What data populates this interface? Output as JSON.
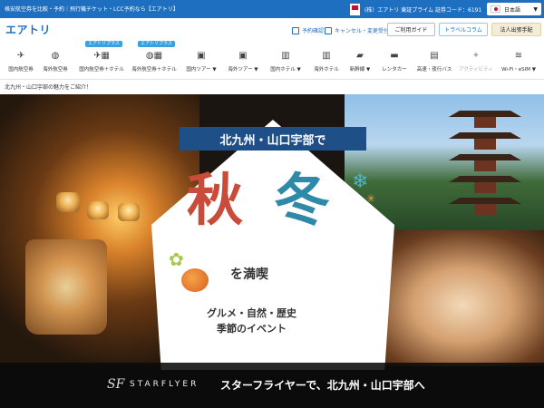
{
  "topbar": {
    "tagline": "格安航空券を比較・予約｜飛行機チケット・LCC予約なら【エアトリ】",
    "company_info": "(株）エアトリ 東証プライム 証券コード：6191",
    "language": "日本語",
    "language_caret": "▼"
  },
  "header": {
    "logo": "エアトリ",
    "links": [
      "予約確認",
      "キャンセル・変更受付"
    ],
    "buttons": [
      "ご利用ガイド",
      "トラベルコラム",
      "法人出張手配"
    ]
  },
  "nav": {
    "badge": "エアトリプラス",
    "items": [
      {
        "label": "国内航空券",
        "icon": "airplane-icon",
        "glyph": "✈"
      },
      {
        "label": "海外航空券",
        "icon": "globe-icon",
        "glyph": "◍"
      },
      {
        "label": "国内航空券＋ホテル",
        "icon": "plane-hotel-icon",
        "glyph": "✈▦"
      },
      {
        "label": "海外航空券＋ホテル",
        "icon": "globe-hotel-icon",
        "glyph": "◍▦"
      },
      {
        "label": "国内ツアー ▼",
        "icon": "suitcase-icon",
        "glyph": "▣"
      },
      {
        "label": "海外ツアー ▼",
        "icon": "suitcase-icon",
        "glyph": "▣"
      },
      {
        "label": "国内ホテル ▼",
        "icon": "hotel-icon",
        "glyph": "▥"
      },
      {
        "label": "海外ホテル",
        "icon": "hotel-icon",
        "glyph": "▥"
      },
      {
        "label": "新幹線 ▼",
        "icon": "bullet-train-icon",
        "glyph": "▰"
      },
      {
        "label": "レンタカー",
        "icon": "car-icon",
        "glyph": "▬"
      },
      {
        "label": "高速・夜行バス",
        "icon": "bus-icon",
        "glyph": "▤"
      },
      {
        "label": "アクティビティ",
        "icon": "activity-icon",
        "glyph": "✦"
      },
      {
        "label": "Wi-Fi・eSIM ▼",
        "icon": "wifi-icon",
        "glyph": "≋"
      }
    ]
  },
  "breadcrumb": "北九州・山口宇部の魅力をご紹介！",
  "hero": {
    "ribbon": "北九州・山口宇部で",
    "aki": "秋",
    "fuyu": "冬",
    "tanshin": "を満喫",
    "sub1": "グルメ・自然・歴史",
    "sub2": "季節のイベント"
  },
  "banner": {
    "mark": "SF",
    "brand": "STARFLYER",
    "text": "スターフライヤーで、北九州・山口宇部へ"
  },
  "colors": {
    "brand_blue": "#1f6fc0",
    "aki_red": "#c94b3a",
    "fuyu_teal": "#2e8aa8",
    "ribbon_navy": "#1e4f86"
  }
}
